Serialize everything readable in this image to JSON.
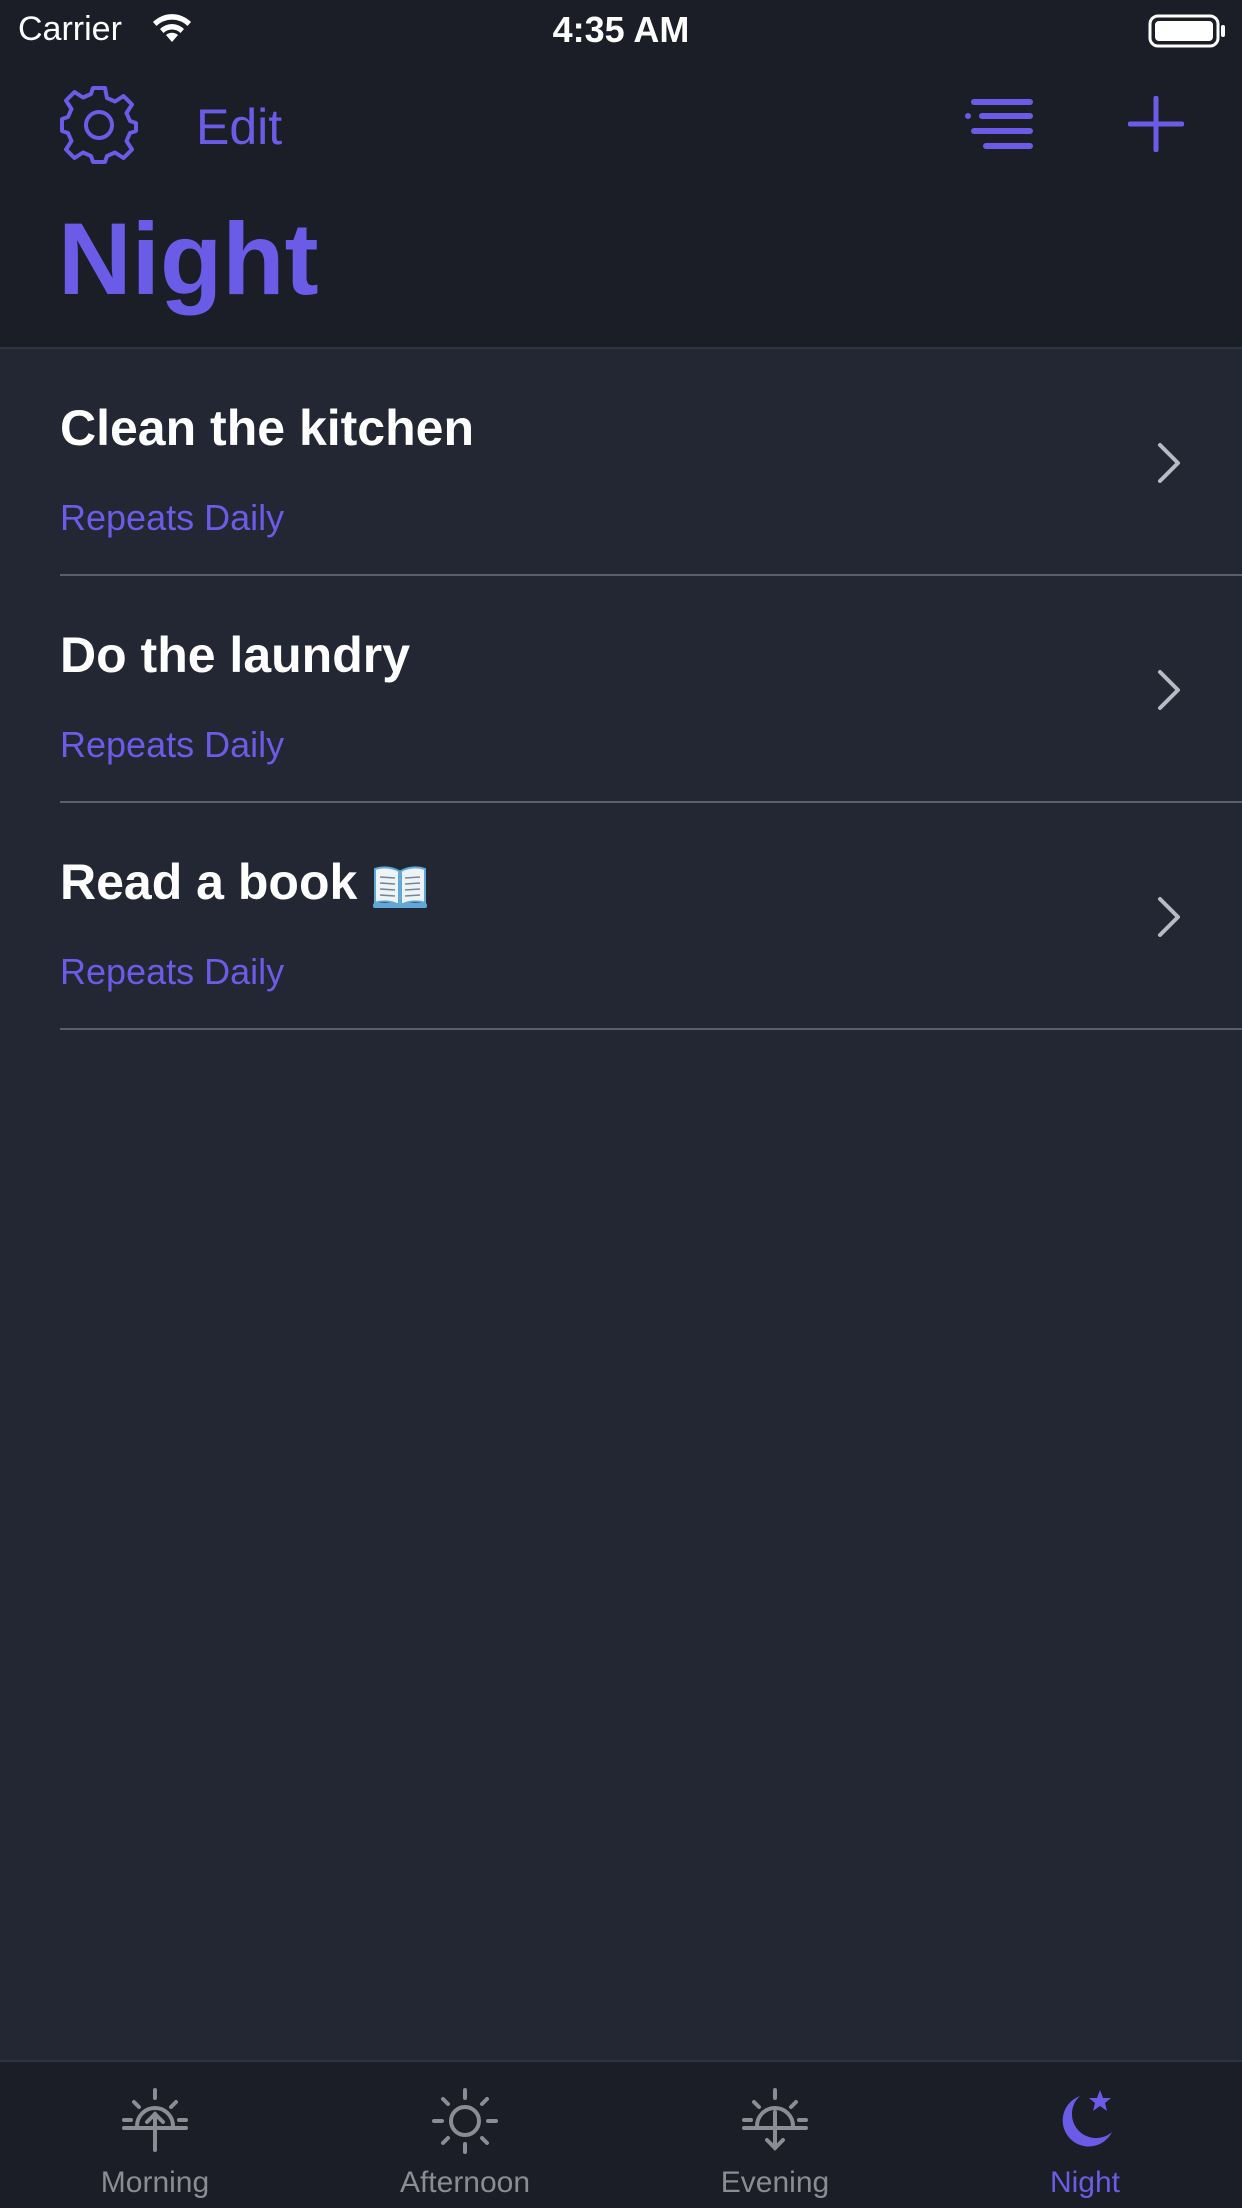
{
  "status_bar": {
    "carrier": "Carrier",
    "time": "4:35 AM"
  },
  "nav": {
    "edit_label": "Edit",
    "title": "Night"
  },
  "tasks": [
    {
      "title": "Clean the kitchen",
      "subtitle": "Repeats Daily",
      "emoji": ""
    },
    {
      "title": "Do the laundry",
      "subtitle": "Repeats Daily",
      "emoji": ""
    },
    {
      "title": "Read a book",
      "subtitle": "Repeats Daily",
      "emoji": "book-icon"
    }
  ],
  "tabs": [
    {
      "label": "Morning",
      "icon": "sunrise-icon",
      "active": false
    },
    {
      "label": "Afternoon",
      "icon": "sun-icon",
      "active": false
    },
    {
      "label": "Evening",
      "icon": "sunset-icon",
      "active": false
    },
    {
      "label": "Night",
      "icon": "moon-star-icon",
      "active": true
    }
  ],
  "colors": {
    "accent": "#6b5ce7",
    "background": "#222733",
    "header_background": "#1b1e26",
    "inactive_tab": "#8a8d94",
    "text": "#ffffff"
  }
}
